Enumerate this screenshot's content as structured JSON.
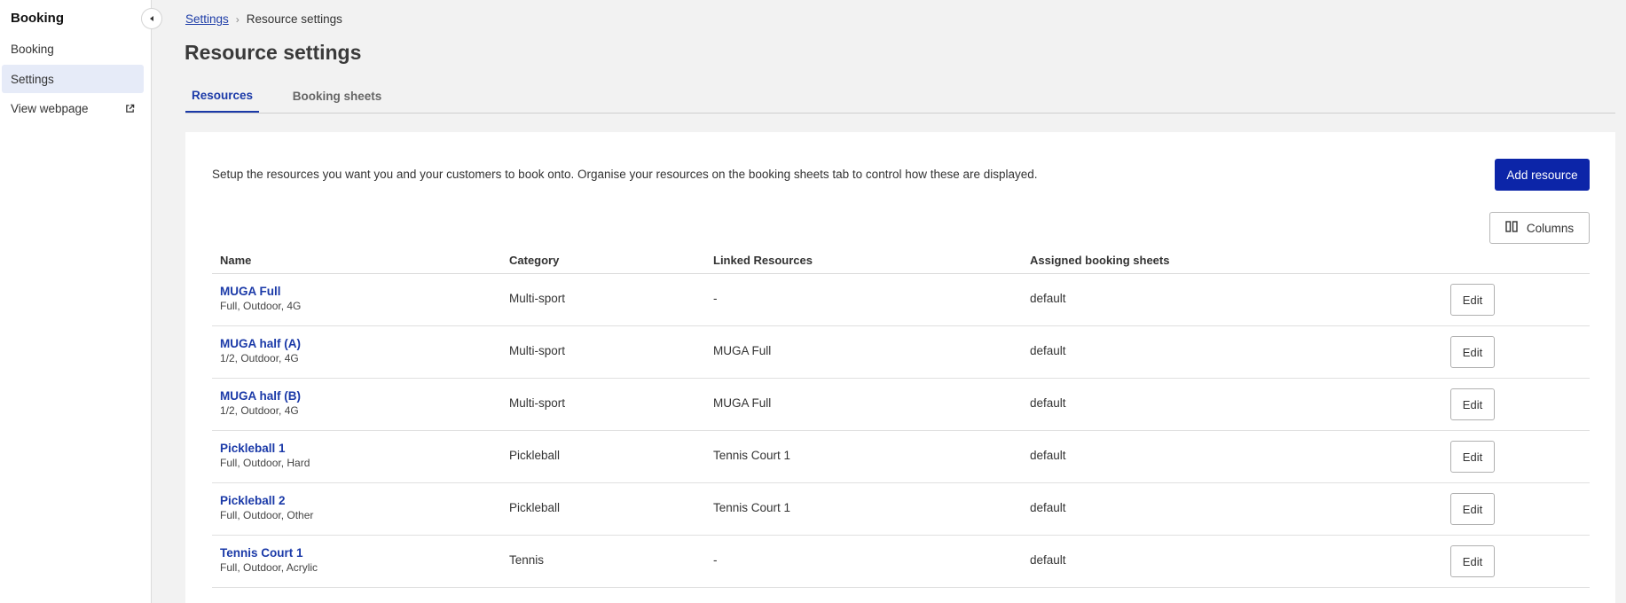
{
  "sidebar": {
    "title": "Booking",
    "items": [
      {
        "label": "Booking"
      },
      {
        "label": "Settings"
      },
      {
        "label": "View webpage"
      }
    ]
  },
  "breadcrumb": {
    "parent": "Settings",
    "current": "Resource settings"
  },
  "page_title": "Resource settings",
  "tabs": [
    {
      "label": "Resources",
      "active": true
    },
    {
      "label": "Booking sheets",
      "active": false
    }
  ],
  "intro": "Setup the resources you want you and your customers to book onto. Organise your resources on the booking sheets tab to control how these are displayed.",
  "buttons": {
    "add_resource": "Add resource",
    "columns": "Columns"
  },
  "table": {
    "headers": [
      "Name",
      "Category",
      "Linked Resources",
      "Assigned booking sheets"
    ],
    "rows": [
      {
        "name": "MUGA Full",
        "details": "Full, Outdoor, 4G",
        "category": "Multi-sport",
        "linked": "-",
        "sheets": "default",
        "action": "Edit"
      },
      {
        "name": "MUGA half (A)",
        "details": "1/2, Outdoor, 4G",
        "category": "Multi-sport",
        "linked": "MUGA Full",
        "sheets": "default",
        "action": "Edit"
      },
      {
        "name": "MUGA half (B)",
        "details": "1/2, Outdoor, 4G",
        "category": "Multi-sport",
        "linked": "MUGA Full",
        "sheets": "default",
        "action": "Edit"
      },
      {
        "name": "Pickleball 1",
        "details": "Full, Outdoor, Hard",
        "category": "Pickleball",
        "linked": "Tennis Court 1",
        "sheets": "default",
        "action": "Edit"
      },
      {
        "name": "Pickleball 2",
        "details": "Full, Outdoor, Other",
        "category": "Pickleball",
        "linked": "Tennis Court 1",
        "sheets": "default",
        "action": "Edit"
      },
      {
        "name": "Tennis Court 1",
        "details": "Full, Outdoor, Acrylic",
        "category": "Tennis",
        "linked": "-",
        "sheets": "default",
        "action": "Edit"
      }
    ]
  },
  "colors": {
    "accent": "#0c25a8",
    "link": "#1b3aa8",
    "nav_active_bg": "#e6ebf8",
    "page_bg": "#f2f2f2"
  },
  "icons": {
    "collapse": "chevron-left-icon",
    "external": "external-link-icon",
    "columns": "columns-icon"
  }
}
